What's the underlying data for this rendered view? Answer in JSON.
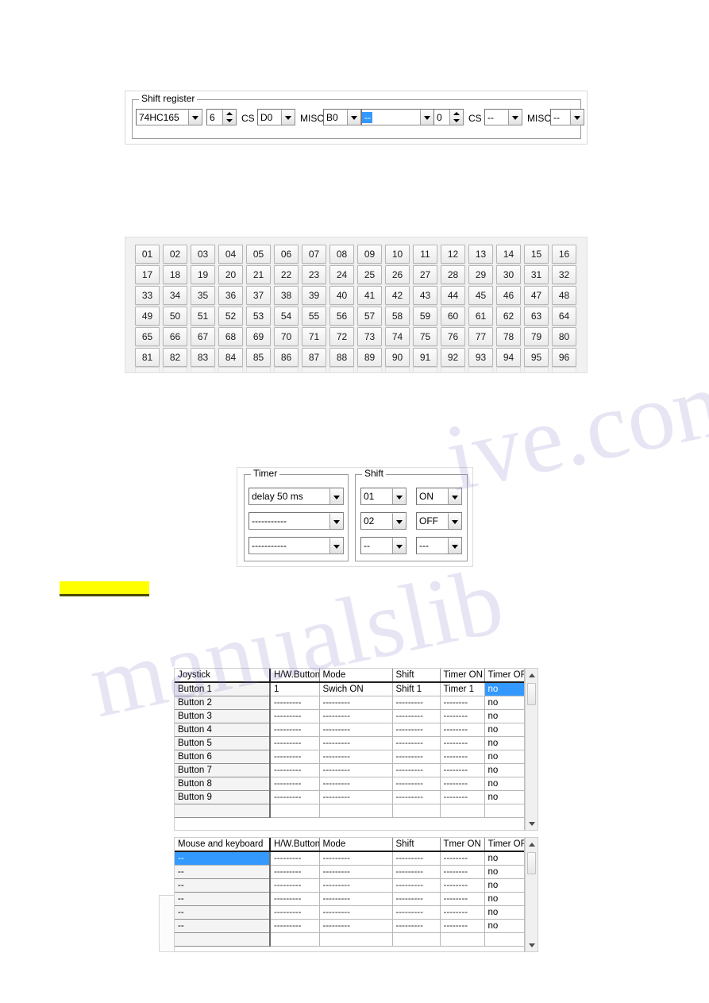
{
  "shift_register": {
    "group_label": "Shift register",
    "chip_combo": {
      "value": "74HC165"
    },
    "count_spin": {
      "value": "6"
    },
    "cs_label_1": "CS",
    "cs_combo_1": {
      "value": "D0"
    },
    "miso_label_1": "MISO",
    "miso_combo_1": {
      "value": "B0"
    },
    "chip_combo_2": {
      "value": "--",
      "selected": true
    },
    "count_spin_2": {
      "value": "0"
    },
    "cs_label_2": "CS",
    "cs_combo_2": {
      "value": "--"
    },
    "miso_label_2": "MISO",
    "miso_combo_2": {
      "value": "--"
    }
  },
  "number_grid": {
    "columns": 16,
    "rows": 6,
    "buttons": [
      "01",
      "02",
      "03",
      "04",
      "05",
      "06",
      "07",
      "08",
      "09",
      "10",
      "11",
      "12",
      "13",
      "14",
      "15",
      "16",
      "17",
      "18",
      "19",
      "20",
      "21",
      "22",
      "23",
      "24",
      "25",
      "26",
      "27",
      "28",
      "29",
      "30",
      "31",
      "32",
      "33",
      "34",
      "35",
      "36",
      "37",
      "38",
      "39",
      "40",
      "41",
      "42",
      "43",
      "44",
      "45",
      "46",
      "47",
      "48",
      "49",
      "50",
      "51",
      "52",
      "53",
      "54",
      "55",
      "56",
      "57",
      "58",
      "59",
      "60",
      "61",
      "62",
      "63",
      "64",
      "65",
      "66",
      "67",
      "68",
      "69",
      "70",
      "71",
      "72",
      "73",
      "74",
      "75",
      "76",
      "77",
      "78",
      "79",
      "80",
      "81",
      "82",
      "83",
      "84",
      "85",
      "86",
      "87",
      "88",
      "89",
      "90",
      "91",
      "92",
      "93",
      "94",
      "95",
      "96"
    ]
  },
  "timer_group": {
    "label": "Timer",
    "combos": [
      {
        "value": "delay 50 ms"
      },
      {
        "value": "-----------"
      },
      {
        "value": "-----------"
      }
    ]
  },
  "shift_group": {
    "label": "Shift",
    "rows": [
      {
        "index": "01",
        "state": "ON"
      },
      {
        "index": "02",
        "state": "OFF"
      },
      {
        "index": "--",
        "state": "---"
      }
    ]
  },
  "highlight_bar": {
    "text": ""
  },
  "joystick_grid": {
    "headers": [
      "Joystick",
      "H/W.Button",
      "Mode",
      "Shift",
      "Timer ON",
      "Timer OFF"
    ],
    "rows": [
      {
        "name": "Button 1",
        "hw": "1",
        "mode": "Swich ON",
        "shift": "Shift 1",
        "timer_on": "Timer 1",
        "timer_off": "no",
        "timer_off_selected": true
      },
      {
        "name": "Button 2",
        "hw": "---------",
        "mode": "---------",
        "shift": "---------",
        "timer_on": "--------",
        "timer_off": "no"
      },
      {
        "name": "Button 3",
        "hw": "---------",
        "mode": "---------",
        "shift": "---------",
        "timer_on": "--------",
        "timer_off": "no"
      },
      {
        "name": "Button 4",
        "hw": "---------",
        "mode": "---------",
        "shift": "---------",
        "timer_on": "--------",
        "timer_off": "no"
      },
      {
        "name": "Button 5",
        "hw": "---------",
        "mode": "---------",
        "shift": "---------",
        "timer_on": "--------",
        "timer_off": "no"
      },
      {
        "name": "Button 6",
        "hw": "---------",
        "mode": "---------",
        "shift": "---------",
        "timer_on": "--------",
        "timer_off": "no"
      },
      {
        "name": "Button 7",
        "hw": "---------",
        "mode": "---------",
        "shift": "---------",
        "timer_on": "--------",
        "timer_off": "no"
      },
      {
        "name": "Button 8",
        "hw": "---------",
        "mode": "---------",
        "shift": "---------",
        "timer_on": "--------",
        "timer_off": "no"
      },
      {
        "name": "Button 9",
        "hw": "---------",
        "mode": "---------",
        "shift": "---------",
        "timer_on": "--------",
        "timer_off": "no"
      }
    ],
    "scrollbar": {
      "position": "top"
    }
  },
  "mouse_keyboard_grid": {
    "headers": [
      "Mouse and keyboard",
      "H/W.Button",
      "Mode",
      "Shift",
      "Tmer ON",
      "Timer OFF"
    ],
    "rows": [
      {
        "name": "--",
        "hw": "---------",
        "mode": "---------",
        "shift": "---------",
        "timer_on": "--------",
        "timer_off": "no",
        "name_selected": true
      },
      {
        "name": "--",
        "hw": "---------",
        "mode": "---------",
        "shift": "---------",
        "timer_on": "--------",
        "timer_off": "no"
      },
      {
        "name": "--",
        "hw": "---------",
        "mode": "---------",
        "shift": "---------",
        "timer_on": "--------",
        "timer_off": "no"
      },
      {
        "name": "--",
        "hw": "---------",
        "mode": "---------",
        "shift": "---------",
        "timer_on": "--------",
        "timer_off": "no"
      },
      {
        "name": "--",
        "hw": "---------",
        "mode": "---------",
        "shift": "---------",
        "timer_on": "--------",
        "timer_off": "no"
      },
      {
        "name": "--",
        "hw": "---------",
        "mode": "---------",
        "shift": "---------",
        "timer_on": "--------",
        "timer_off": "no"
      }
    ],
    "scrollbar": {
      "position": "top"
    }
  },
  "colors": {
    "selection": "#3399ff",
    "highlight": "#ffff00",
    "panel": "#f1f1f1"
  },
  "watermark": {
    "line1": "ive.com",
    "line2": "manualslib"
  }
}
